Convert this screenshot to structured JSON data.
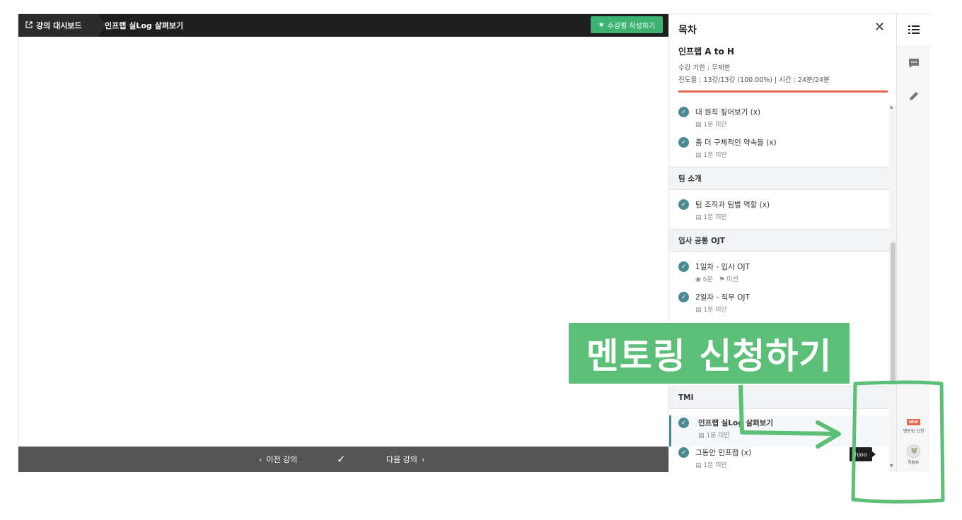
{
  "topbar": {
    "dashboard_label": "강의 대시보드",
    "lecture_title": "인프랩 실Log 살펴보기",
    "review_button": "수강평 작성하기"
  },
  "bottombar": {
    "prev_label": "이전 강의",
    "check_icon": "✓",
    "next_label": "다음 강의"
  },
  "toc": {
    "title": "목차",
    "course_name": "인프랩 A to H",
    "period": "수강 기한 : 무제한",
    "progress_text": "진도율 : 13강/13강 (100.00%) | 시간 : 24분/24분",
    "progress_fraction": 1.0,
    "progress_color": "#e8664f",
    "accent_color": "#4a8a93",
    "items": [
      {
        "name": "대 원칙 짚어보기 (x)",
        "sub": "1분 미만"
      },
      {
        "name": "좀 더 구체적인 약속들 (x)",
        "sub": "1분 미만"
      },
      {
        "name": "팀 조직과 팀별 역할 (x)",
        "sub": "1분 미만"
      },
      {
        "name": "1일차 - 입사 OJT",
        "sub": "6분",
        "sub2": "미션"
      },
      {
        "name": "2일차 - 직무 OJT",
        "sub": "1분 미만"
      },
      {
        "name": "인프랩 실Log 살펴보기",
        "sub": "1분 미만"
      },
      {
        "name": "그동안 인프랩 (x)",
        "sub": "1분 미만"
      }
    ],
    "sections": [
      "팀 소개",
      "입사 공통 OJT",
      "TMI"
    ]
  },
  "rail": {
    "new_badge": "NEW",
    "mentor_label": "멘토링 신청",
    "user_name": "hjoo",
    "tooltip": "hjoo"
  },
  "annotation": {
    "callout": "멘토링 신청하기",
    "color": "#5cbf78"
  }
}
